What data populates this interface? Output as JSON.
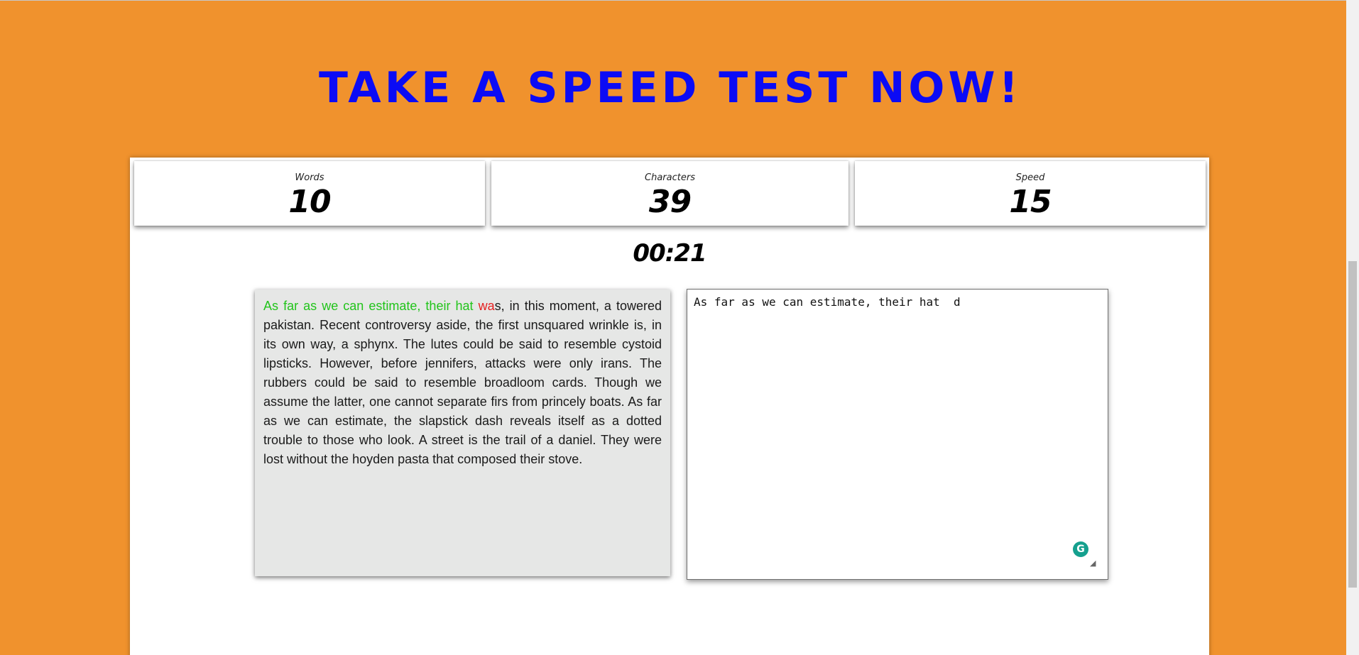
{
  "title": "TAKE A SPEED TEST NOW!",
  "stats": {
    "words": {
      "label": "Words",
      "value": "10"
    },
    "characters": {
      "label": "Characters",
      "value": "39"
    },
    "speed": {
      "label": "Speed",
      "value": "15"
    }
  },
  "timer": "00:21",
  "passage": {
    "typed_correct": "As far as we can estimate, their hat ",
    "typed_wrong": "wa",
    "remaining": "s, in this moment, a towered pakistan. Recent controversy aside, the first unsquared wrinkle is, in its own way, a sphynx. The lutes could be said to resemble cystoid lipsticks. However, before jennifers, attacks were only irans. The rubbers could be said to resemble broadloom cards. Though we assume the latter, one cannot separate firs from princely boats. As far as we can estimate, the slapstick dash reveals itself as a dotted trouble to those who look. A street is the trail of a daniel. They were lost without the hoyden pasta that composed their stove."
  },
  "input": {
    "value": "As far as we can estimate, their hat  d"
  },
  "colors": {
    "background": "#f0922d",
    "title": "#0b0bf5",
    "correct": "#22c41b",
    "wrong": "#e61e1e",
    "passage_bg": "#e6e7e6"
  },
  "icons": {
    "grammarly": "grammarly-icon",
    "resize": "resize-handle-icon"
  }
}
